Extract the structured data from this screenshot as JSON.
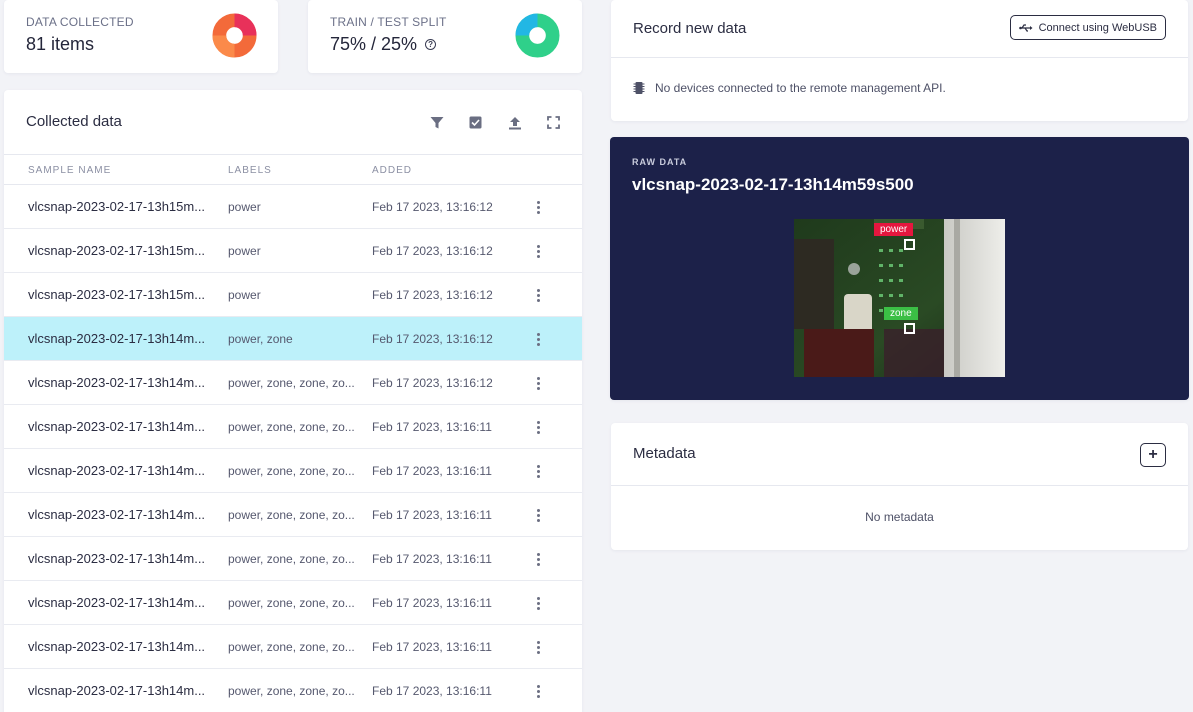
{
  "stats": {
    "collected": {
      "label": "DATA COLLECTED",
      "value": "81 items"
    },
    "split": {
      "label": "TRAIN / TEST SPLIT",
      "value": "75% / 25%"
    }
  },
  "collected": {
    "title": "Collected data",
    "toolbar": {
      "filter_icon": "filter-icon",
      "select_icon": "checkbox-icon",
      "upload_icon": "upload-icon",
      "expand_icon": "expand-icon"
    },
    "columns": {
      "name": "SAMPLE NAME",
      "labels": "LABELS",
      "added": "ADDED"
    },
    "rows": [
      {
        "name": "vlcsnap-2023-02-17-13h15m...",
        "labels": "power",
        "added": "Feb 17 2023, 13:16:12"
      },
      {
        "name": "vlcsnap-2023-02-17-13h15m...",
        "labels": "power",
        "added": "Feb 17 2023, 13:16:12"
      },
      {
        "name": "vlcsnap-2023-02-17-13h15m...",
        "labels": "power",
        "added": "Feb 17 2023, 13:16:12"
      },
      {
        "name": "vlcsnap-2023-02-17-13h14m...",
        "labels": "power, zone",
        "added": "Feb 17 2023, 13:16:12",
        "selected": true
      },
      {
        "name": "vlcsnap-2023-02-17-13h14m...",
        "labels": "power, zone, zone, zo...",
        "added": "Feb 17 2023, 13:16:12"
      },
      {
        "name": "vlcsnap-2023-02-17-13h14m...",
        "labels": "power, zone, zone, zo...",
        "added": "Feb 17 2023, 13:16:11"
      },
      {
        "name": "vlcsnap-2023-02-17-13h14m...",
        "labels": "power, zone, zone, zo...",
        "added": "Feb 17 2023, 13:16:11"
      },
      {
        "name": "vlcsnap-2023-02-17-13h14m...",
        "labels": "power, zone, zone, zo...",
        "added": "Feb 17 2023, 13:16:11"
      },
      {
        "name": "vlcsnap-2023-02-17-13h14m...",
        "labels": "power, zone, zone, zo...",
        "added": "Feb 17 2023, 13:16:11"
      },
      {
        "name": "vlcsnap-2023-02-17-13h14m...",
        "labels": "power, zone, zone, zo...",
        "added": "Feb 17 2023, 13:16:11"
      },
      {
        "name": "vlcsnap-2023-02-17-13h14m...",
        "labels": "power, zone, zone, zo...",
        "added": "Feb 17 2023, 13:16:11"
      },
      {
        "name": "vlcsnap-2023-02-17-13h14m...",
        "labels": "power, zone, zone, zo...",
        "added": "Feb 17 2023, 13:16:11"
      }
    ]
  },
  "record": {
    "title": "Record new data",
    "webusb_button": "Connect using WebUSB",
    "status": "No devices connected to the remote management API."
  },
  "raw": {
    "label": "RAW DATA",
    "title": "vlcsnap-2023-02-17-13h14m59s500",
    "boxes": {
      "power": "power",
      "zone": "zone"
    }
  },
  "metadata": {
    "title": "Metadata",
    "add_symbol": "+",
    "empty": "No metadata"
  },
  "colors": {
    "accent_selected": "#bdf1fa",
    "raw_bg": "#1c2149",
    "power_box": "#e5163e",
    "zone_box": "#3bbf45"
  }
}
